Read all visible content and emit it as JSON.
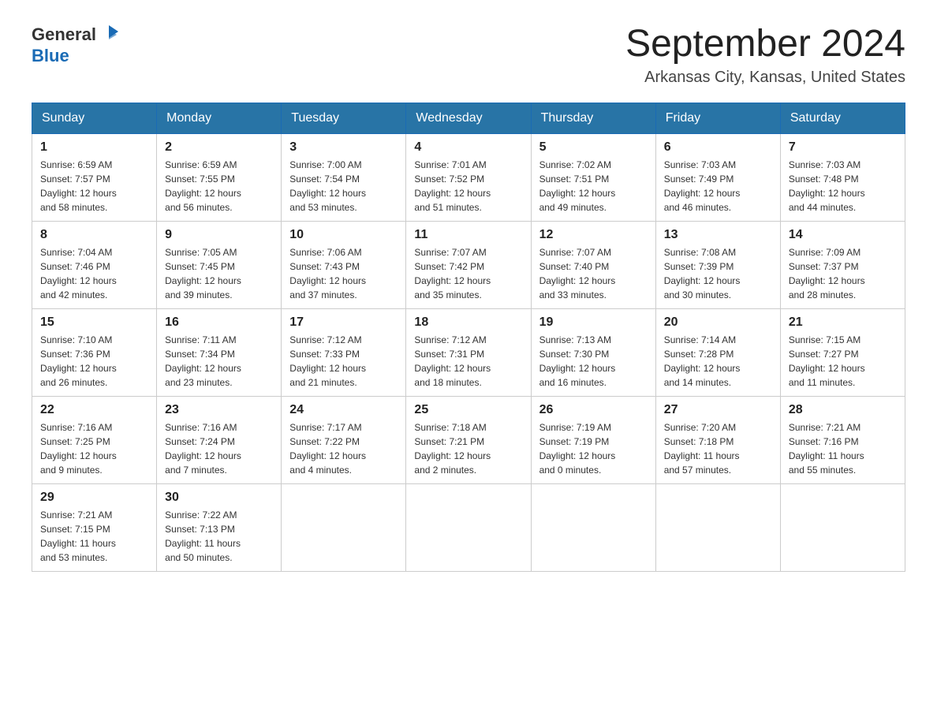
{
  "header": {
    "logo_general": "General",
    "logo_blue": "Blue",
    "month_title": "September 2024",
    "location": "Arkansas City, Kansas, United States"
  },
  "days_of_week": [
    "Sunday",
    "Monday",
    "Tuesday",
    "Wednesday",
    "Thursday",
    "Friday",
    "Saturday"
  ],
  "weeks": [
    [
      {
        "day": "1",
        "sunrise": "6:59 AM",
        "sunset": "7:57 PM",
        "daylight": "12 hours and 58 minutes."
      },
      {
        "day": "2",
        "sunrise": "6:59 AM",
        "sunset": "7:55 PM",
        "daylight": "12 hours and 56 minutes."
      },
      {
        "day": "3",
        "sunrise": "7:00 AM",
        "sunset": "7:54 PM",
        "daylight": "12 hours and 53 minutes."
      },
      {
        "day": "4",
        "sunrise": "7:01 AM",
        "sunset": "7:52 PM",
        "daylight": "12 hours and 51 minutes."
      },
      {
        "day": "5",
        "sunrise": "7:02 AM",
        "sunset": "7:51 PM",
        "daylight": "12 hours and 49 minutes."
      },
      {
        "day": "6",
        "sunrise": "7:03 AM",
        "sunset": "7:49 PM",
        "daylight": "12 hours and 46 minutes."
      },
      {
        "day": "7",
        "sunrise": "7:03 AM",
        "sunset": "7:48 PM",
        "daylight": "12 hours and 44 minutes."
      }
    ],
    [
      {
        "day": "8",
        "sunrise": "7:04 AM",
        "sunset": "7:46 PM",
        "daylight": "12 hours and 42 minutes."
      },
      {
        "day": "9",
        "sunrise": "7:05 AM",
        "sunset": "7:45 PM",
        "daylight": "12 hours and 39 minutes."
      },
      {
        "day": "10",
        "sunrise": "7:06 AM",
        "sunset": "7:43 PM",
        "daylight": "12 hours and 37 minutes."
      },
      {
        "day": "11",
        "sunrise": "7:07 AM",
        "sunset": "7:42 PM",
        "daylight": "12 hours and 35 minutes."
      },
      {
        "day": "12",
        "sunrise": "7:07 AM",
        "sunset": "7:40 PM",
        "daylight": "12 hours and 33 minutes."
      },
      {
        "day": "13",
        "sunrise": "7:08 AM",
        "sunset": "7:39 PM",
        "daylight": "12 hours and 30 minutes."
      },
      {
        "day": "14",
        "sunrise": "7:09 AM",
        "sunset": "7:37 PM",
        "daylight": "12 hours and 28 minutes."
      }
    ],
    [
      {
        "day": "15",
        "sunrise": "7:10 AM",
        "sunset": "7:36 PM",
        "daylight": "12 hours and 26 minutes."
      },
      {
        "day": "16",
        "sunrise": "7:11 AM",
        "sunset": "7:34 PM",
        "daylight": "12 hours and 23 minutes."
      },
      {
        "day": "17",
        "sunrise": "7:12 AM",
        "sunset": "7:33 PM",
        "daylight": "12 hours and 21 minutes."
      },
      {
        "day": "18",
        "sunrise": "7:12 AM",
        "sunset": "7:31 PM",
        "daylight": "12 hours and 18 minutes."
      },
      {
        "day": "19",
        "sunrise": "7:13 AM",
        "sunset": "7:30 PM",
        "daylight": "12 hours and 16 minutes."
      },
      {
        "day": "20",
        "sunrise": "7:14 AM",
        "sunset": "7:28 PM",
        "daylight": "12 hours and 14 minutes."
      },
      {
        "day": "21",
        "sunrise": "7:15 AM",
        "sunset": "7:27 PM",
        "daylight": "12 hours and 11 minutes."
      }
    ],
    [
      {
        "day": "22",
        "sunrise": "7:16 AM",
        "sunset": "7:25 PM",
        "daylight": "12 hours and 9 minutes."
      },
      {
        "day": "23",
        "sunrise": "7:16 AM",
        "sunset": "7:24 PM",
        "daylight": "12 hours and 7 minutes."
      },
      {
        "day": "24",
        "sunrise": "7:17 AM",
        "sunset": "7:22 PM",
        "daylight": "12 hours and 4 minutes."
      },
      {
        "day": "25",
        "sunrise": "7:18 AM",
        "sunset": "7:21 PM",
        "daylight": "12 hours and 2 minutes."
      },
      {
        "day": "26",
        "sunrise": "7:19 AM",
        "sunset": "7:19 PM",
        "daylight": "12 hours and 0 minutes."
      },
      {
        "day": "27",
        "sunrise": "7:20 AM",
        "sunset": "7:18 PM",
        "daylight": "11 hours and 57 minutes."
      },
      {
        "day": "28",
        "sunrise": "7:21 AM",
        "sunset": "7:16 PM",
        "daylight": "11 hours and 55 minutes."
      }
    ],
    [
      {
        "day": "29",
        "sunrise": "7:21 AM",
        "sunset": "7:15 PM",
        "daylight": "11 hours and 53 minutes."
      },
      {
        "day": "30",
        "sunrise": "7:22 AM",
        "sunset": "7:13 PM",
        "daylight": "11 hours and 50 minutes."
      },
      null,
      null,
      null,
      null,
      null
    ]
  ],
  "labels": {
    "sunrise": "Sunrise:",
    "sunset": "Sunset:",
    "daylight": "Daylight:"
  }
}
